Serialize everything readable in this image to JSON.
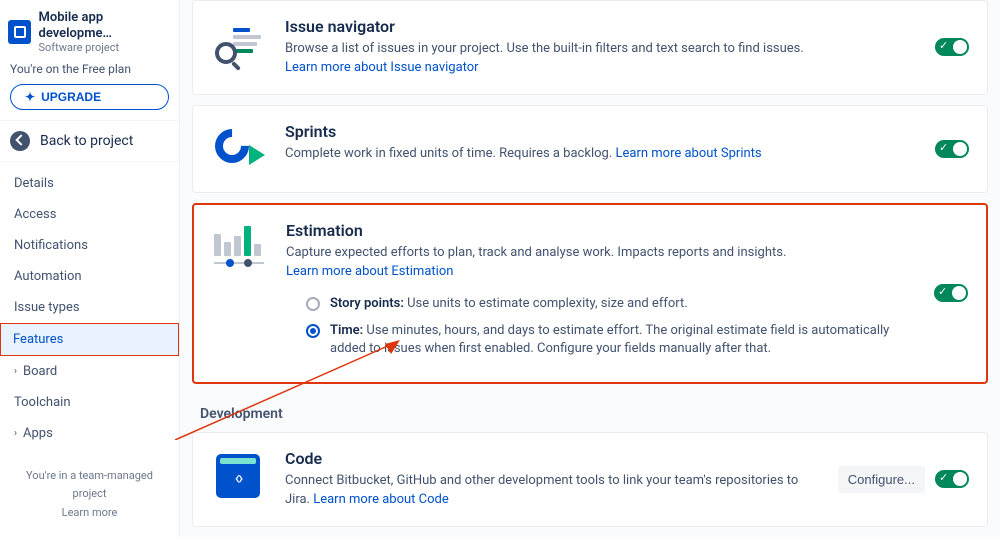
{
  "project": {
    "title": "Mobile app developme…",
    "subtitle": "Software project"
  },
  "plan_note": "You're on the Free plan",
  "upgrade_label": "UPGRADE",
  "back_label": "Back to project",
  "nav": {
    "details": "Details",
    "access": "Access",
    "notifications": "Notifications",
    "automation": "Automation",
    "issue_types": "Issue types",
    "features": "Features",
    "board": "Board",
    "toolchain": "Toolchain",
    "apps": "Apps"
  },
  "sidebar_footer": {
    "line": "You're in a team-managed project",
    "link": "Learn more"
  },
  "features": {
    "issue_navigator": {
      "title": "Issue navigator",
      "desc": "Browse a list of issues in your project. Use the built-in filters and text search to find issues.",
      "link": "Learn more about Issue navigator"
    },
    "sprints": {
      "title": "Sprints",
      "desc": "Complete work in fixed units of time. Requires a backlog. ",
      "link": "Learn more about Sprints"
    },
    "estimation": {
      "title": "Estimation",
      "desc": "Capture expected efforts to plan, track and analyse work. Impacts reports and insights.",
      "link": "Learn more about Estimation",
      "options": {
        "story_points": {
          "label": "Story points:",
          "text": " Use units to estimate complexity, size and effort."
        },
        "time": {
          "label": "Time:",
          "text": " Use minutes, hours, and days to estimate effort. The original estimate field is automatically added to issues when first enabled. Configure your fields manually after that."
        }
      }
    }
  },
  "section_dev": "Development",
  "dev": {
    "code": {
      "title": "Code",
      "desc": "Connect Bitbucket, GitHub and other development tools to link your team's repositories to Jira. ",
      "link": "Learn more about Code",
      "configure": "Configure..."
    }
  }
}
